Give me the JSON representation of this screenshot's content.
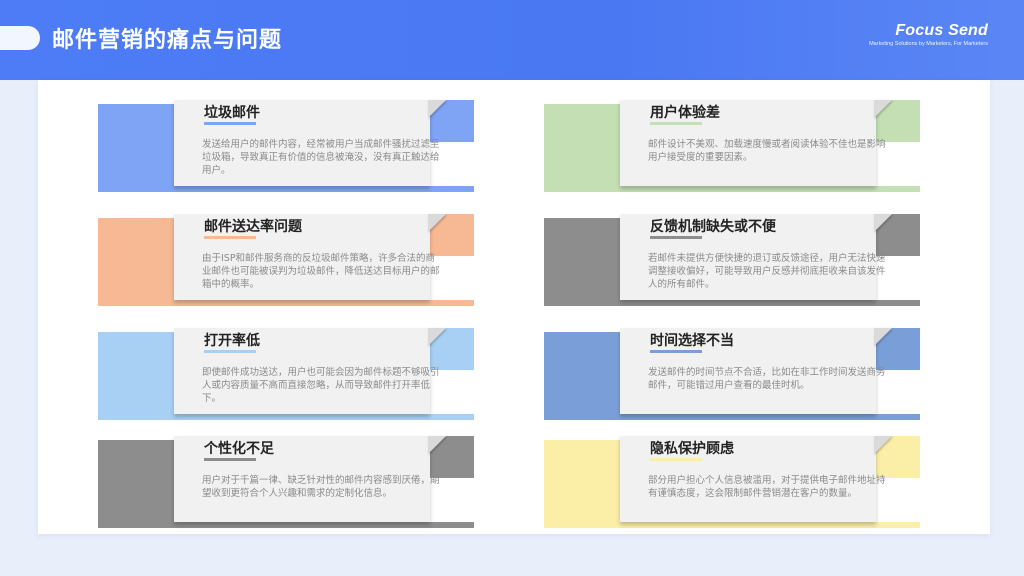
{
  "header": {
    "title": "邮件营销的痛点与问题",
    "logo_text": "Focus Send",
    "logo_tagline": "Marketing Solutions by Marketers, For Marketers"
  },
  "colors": {
    "header_blue": "#4d7cf6",
    "blue": "#7fa3f5",
    "green": "#c3dfb3",
    "orange": "#f6b994",
    "gray": "#8d8d8d",
    "light_blue": "#a8d0f5",
    "steel_blue": "#7a9fd8",
    "yellow": "#fbeea7"
  },
  "cards": [
    {
      "title": "垃圾邮件",
      "desc": "发送给用户的邮件内容，经常被用户当成邮件骚扰过滤至垃圾箱，导致真正有价值的信息被淹没，没有真正触达给用户。",
      "color": "blue"
    },
    {
      "title": "用户体验差",
      "desc": "邮件设计不美观、加载速度慢或者阅读体验不佳也是影响用户接受度的重要因素。",
      "color": "green"
    },
    {
      "title": "邮件送达率问题",
      "desc": "由于ISP和邮件服务商的反垃圾邮件策略，许多合法的商业邮件也可能被误判为垃圾邮件，降低送达目标用户的邮箱中的概率。",
      "color": "orange"
    },
    {
      "title": "反馈机制缺失或不便",
      "desc": "若邮件未提供方便快捷的退订或反馈途径，用户无法快速调整接收偏好，可能导致用户反感并彻底拒收来自该发件人的所有邮件。",
      "color": "gray"
    },
    {
      "title": "打开率低",
      "desc": "即使邮件成功送达，用户也可能会因为邮件标题不够吸引人或内容质量不高而直接忽略，从而导致邮件打开率低下。",
      "color": "light_blue"
    },
    {
      "title": "时间选择不当",
      "desc": "发送邮件的时间节点不合适，比如在非工作时间发送商务邮件，可能错过用户查看的最佳时机。",
      "color": "steel_blue"
    },
    {
      "title": "个性化不足",
      "desc": "用户对于千篇一律、缺乏针对性的邮件内容感到厌倦，期望收到更符合个人兴趣和需求的定制化信息。",
      "color": "gray"
    },
    {
      "title": "隐私保护顾虑",
      "desc": "部分用户担心个人信息被滥用，对于提供电子邮件地址持有谨慎态度，这会限制邮件营销潜在客户的数量。",
      "color": "yellow"
    }
  ]
}
